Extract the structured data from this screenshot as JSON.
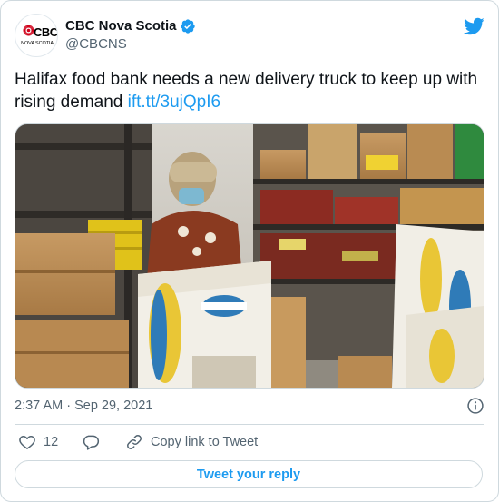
{
  "author": {
    "display_name": "CBC Nova Scotia",
    "handle": "@CBCNS",
    "avatar_brand": "CBC",
    "avatar_region": "NOVA SCOTIA",
    "verified": true
  },
  "tweet": {
    "text": "Halifax food bank needs a new delivery truck to keep up with rising demand ",
    "link": "ift.tt/3ujQpI6"
  },
  "timestamp": {
    "time": "2:37 AM",
    "separator": " · ",
    "date": "Sep 29, 2021"
  },
  "actions": {
    "like_count": "12",
    "copy_link_label": "Copy link to Tweet"
  },
  "reply_button": {
    "label": "Tweet your reply"
  },
  "icons": {
    "bird": "twitter-bird-icon",
    "verified": "verified-badge-icon",
    "info": "info-icon",
    "like": "heart-icon",
    "reply": "speech-bubble-icon",
    "copy": "link-icon"
  },
  "colors": {
    "accent": "#1d9bf0",
    "text": "#0f1419",
    "muted": "#536471",
    "border": "#cfd9de"
  }
}
